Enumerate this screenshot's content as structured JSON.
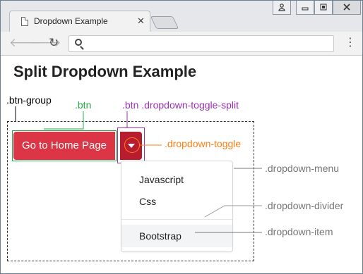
{
  "browser": {
    "tab_title": "Dropdown Example",
    "tab_close": "✕",
    "window_controls": [
      "user-icon",
      "minimize-icon",
      "maximize-icon",
      "close-icon"
    ],
    "nav": {
      "back": "🡐",
      "forward": "🡒",
      "reload": "↻",
      "menu": "⋮"
    },
    "address": ""
  },
  "page": {
    "title": "Split Dropdown Example",
    "main_button": "Go to Home Page",
    "dropdown_items": [
      "Javascript",
      "Css",
      "Bootstrap"
    ],
    "active_item": "Bootstrap"
  },
  "annotations": {
    "btn_group": ".btn-group",
    "btn": ".btn",
    "toggle_split": ".btn .dropdown-toggle-split",
    "dropdown_toggle": ".dropdown-toggle",
    "dropdown_menu": ".dropdown-menu",
    "dropdown_divider": ".dropdown-divider",
    "dropdown_item": ".dropdown-item"
  },
  "colors": {
    "danger": "#dc3545",
    "danger_dark": "#b81c2e",
    "btn_annotation": "#28a745",
    "split_annotation": "#9b30b4",
    "toggle_annotation": "#fd7e14",
    "menu_annotation": "#777777"
  }
}
